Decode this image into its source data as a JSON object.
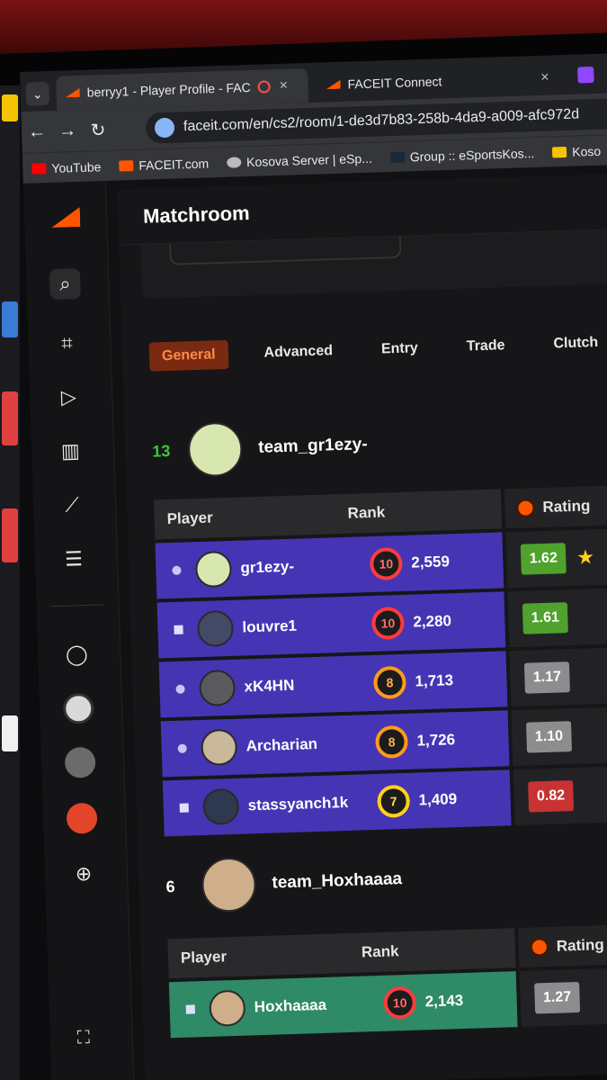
{
  "browser": {
    "tabs": [
      {
        "title": "berryy1 - Player Profile - FAC",
        "close": "×"
      },
      {
        "title": "FACEIT Connect",
        "close": "×"
      }
    ],
    "url": "faceit.com/en/cs2/room/1-de3d7b83-258b-4da9-a009-afc972d",
    "bookmarks": [
      "YouTube",
      "FACEIT.com",
      "Kosova Server | eSp...",
      "Group :: eSportsKos...",
      "Koso"
    ]
  },
  "page": {
    "title": "Matchroom",
    "stat_tabs": [
      "General",
      "Advanced",
      "Entry",
      "Trade",
      "Clutch"
    ],
    "active_tab": "General"
  },
  "teams": [
    {
      "number": "13",
      "name": "team_gr1ezy-",
      "columns": {
        "player": "Player",
        "rank": "Rank",
        "rating": "Rating"
      },
      "players": [
        {
          "name": "gr1ezy-",
          "level": "10",
          "elo": "2,559",
          "rating": "1.62",
          "star": "★"
        },
        {
          "name": "louvre1",
          "level": "10",
          "elo": "2,280",
          "rating": "1.61",
          "star": ""
        },
        {
          "name": "xK4HN",
          "level": "8",
          "elo": "1,713",
          "rating": "1.17",
          "star": ""
        },
        {
          "name": "Archarian",
          "level": "8",
          "elo": "1,726",
          "rating": "1.10",
          "star": ""
        },
        {
          "name": "stassyanch1k",
          "level": "7",
          "elo": "1,409",
          "rating": "0.82",
          "star": ""
        }
      ]
    },
    {
      "number": "6",
      "name": "team_Hoxhaaaa",
      "columns": {
        "player": "Player",
        "rank": "Rank",
        "rating": "Rating"
      },
      "players": [
        {
          "name": "Hoxhaaaa",
          "level": "10",
          "elo": "2,143",
          "rating": "1.27",
          "star": ""
        }
      ]
    }
  ],
  "colors": {
    "accent": "#ff5500",
    "team1_row": "#4535b4",
    "team2_row": "#2f8a68"
  },
  "icons": [
    "search-icon",
    "watch-icon",
    "play-icon",
    "bar-chart-icon",
    "line-chart-icon",
    "list-icon",
    "party-icon",
    "expand-icon"
  ]
}
